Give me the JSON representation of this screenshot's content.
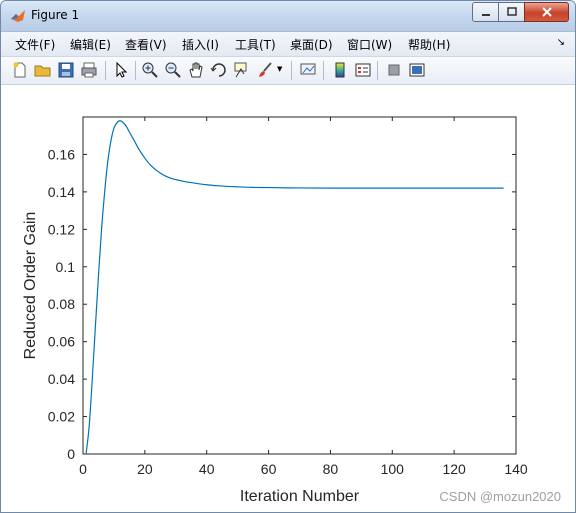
{
  "window": {
    "title": "Figure 1"
  },
  "menu": [
    {
      "label": "文件(F)"
    },
    {
      "label": "编辑(E)"
    },
    {
      "label": "查看(V)"
    },
    {
      "label": "插入(I)"
    },
    {
      "label": "工具(T)"
    },
    {
      "label": "桌面(D)"
    },
    {
      "label": "窗口(W)"
    },
    {
      "label": "帮助(H)"
    }
  ],
  "toolbar": [
    "new-figure-icon",
    "open-icon",
    "save-icon",
    "print-icon",
    "pointer-icon",
    "zoom-in-icon",
    "zoom-out-icon",
    "pan-icon",
    "rotate-icon",
    "data-cursor-icon",
    "brush-icon",
    "link-plot-icon",
    "colorbar-icon",
    "legend-icon",
    "hide-plot-tools-icon",
    "show-plot-tools-icon"
  ],
  "watermark": "CSDN @mozun2020",
  "chart_data": {
    "type": "line",
    "xlabel": "Iteration Number",
    "ylabel": "Reduced Order Gain",
    "xlim": [
      0,
      140
    ],
    "ylim": [
      0,
      0.18
    ],
    "xticks": [
      "0",
      "20",
      "40",
      "60",
      "80",
      "100",
      "120",
      "140"
    ],
    "yticks": [
      "0",
      "0.02",
      "0.04",
      "0.06",
      "0.08",
      "0.1",
      "0.12",
      "0.14",
      "0.16"
    ],
    "line_color": "#0072bd",
    "x": [
      1,
      2,
      3,
      4,
      5,
      6,
      7,
      8,
      9,
      10,
      11,
      12,
      13,
      14,
      15,
      16,
      17,
      18,
      20,
      22,
      25,
      28,
      32,
      36,
      40,
      45,
      50,
      55,
      60,
      70,
      80,
      90,
      100,
      110,
      120,
      130,
      136
    ],
    "y": [
      0.0,
      0.015,
      0.04,
      0.068,
      0.095,
      0.12,
      0.14,
      0.156,
      0.167,
      0.174,
      0.177,
      0.178,
      0.177,
      0.175,
      0.172,
      0.169,
      0.166,
      0.163,
      0.158,
      0.154,
      0.15,
      0.1475,
      0.1458,
      0.1447,
      0.1438,
      0.1431,
      0.1427,
      0.1424,
      0.1423,
      0.1421,
      0.142,
      0.142,
      0.142,
      0.142,
      0.142,
      0.142,
      0.142
    ]
  }
}
